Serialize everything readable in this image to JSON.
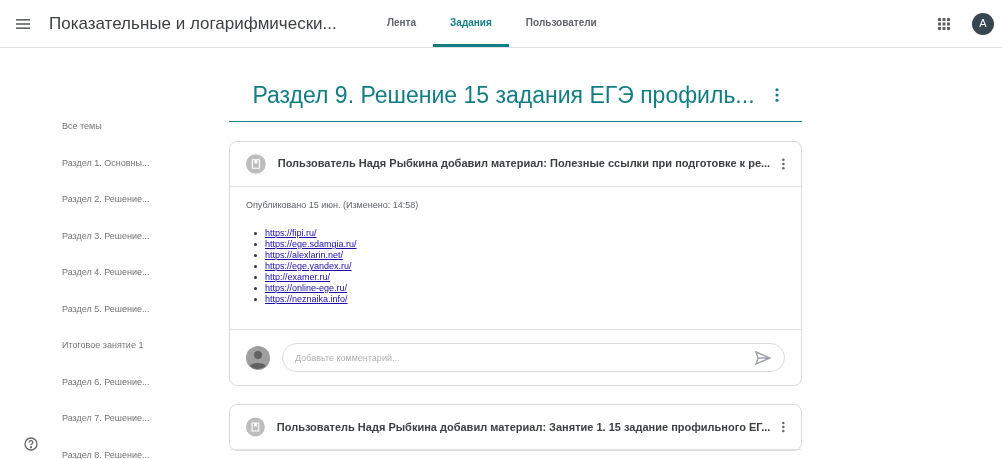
{
  "header": {
    "course_title": "Показательные и логарифмически...",
    "tabs": [
      {
        "label": "Лента",
        "selected": false
      },
      {
        "label": "Задания",
        "selected": true
      },
      {
        "label": "Пользователи",
        "selected": false
      }
    ],
    "avatar": "A"
  },
  "topics": [
    "Все темы",
    "Раздел 1. Основны...",
    "Раздел 2. Решение...",
    "Раздел 3. Решение...",
    "Раздел 4. Решение...",
    "Раздел 5. Решение...",
    "Итоговое занятие 1",
    "Раздел 6. Решение...",
    "Раздел 7. Решение...",
    "Раздел 8. Решение..."
  ],
  "section_title": "Раздел 9. Решение 15 задания ЕГЭ профиль...",
  "posts": [
    {
      "title": "Пользователь Надя Рыбкина добавил материал: Полезные ссылки при подготовке к ре...",
      "published": "Опубликовано 15 июн. (Изменено: 14:58)",
      "links": [
        "https://fipi.ru/",
        "https://ege.sdamgia.ru/",
        "https://alexlarin.net/",
        "https://ege.yandex.ru/",
        "http://examer.ru/",
        "https://online-ege.ru/",
        "https://neznaika.info/"
      ],
      "comment_placeholder": "Добавьте комментарий..."
    },
    {
      "title": "Пользователь Надя Рыбкина добавил материал: Занятие 1. 15 задание профильного ЕГ..."
    }
  ]
}
